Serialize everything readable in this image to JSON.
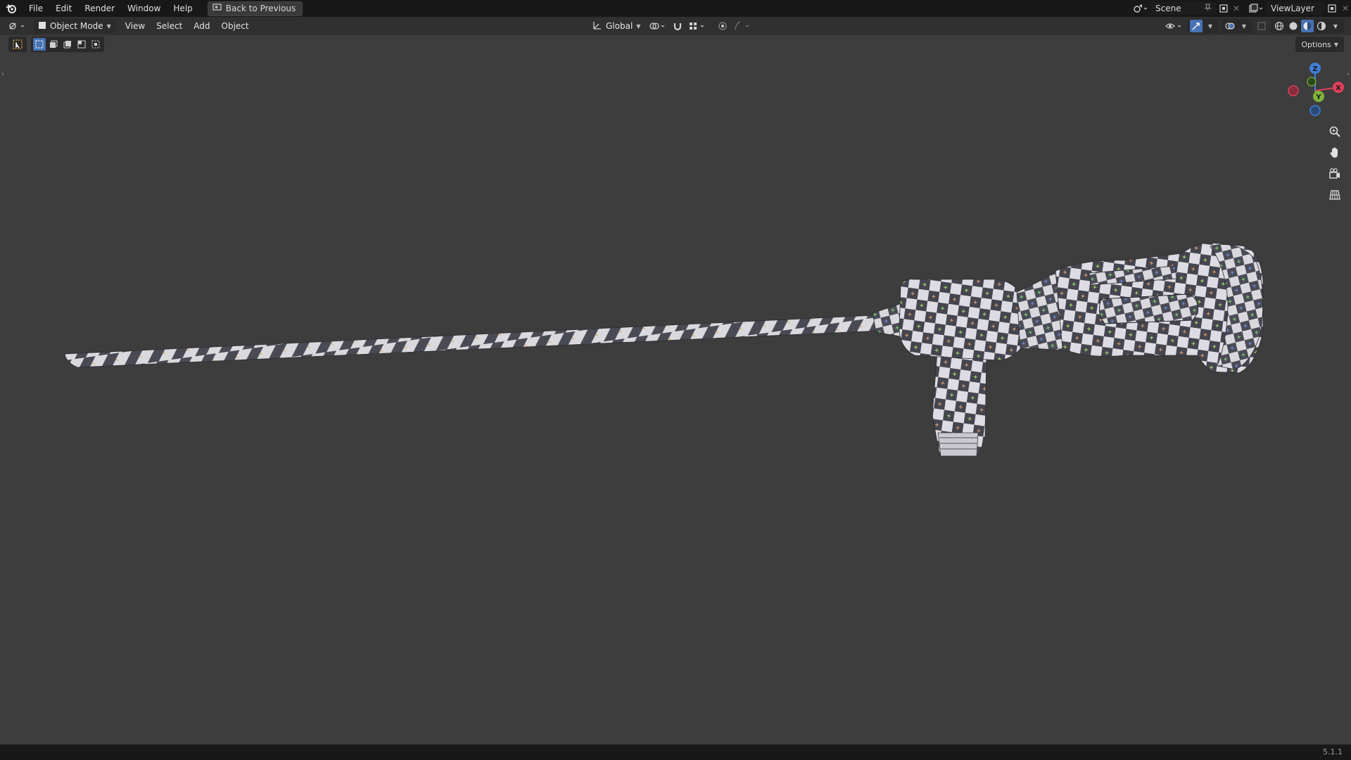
{
  "topbar": {
    "menu": [
      "File",
      "Edit",
      "Render",
      "Window",
      "Help"
    ],
    "back_button": "Back to Previous",
    "scene_name": "Scene",
    "view_layer": "ViewLayer"
  },
  "header": {
    "mode": "Object Mode",
    "menus": [
      "View",
      "Select",
      "Add",
      "Object"
    ],
    "transform_orientation": "Global",
    "options_label": "Options"
  },
  "gizmo": {
    "x": "X",
    "y": "Y",
    "z": "Z"
  },
  "status": {
    "version": "5.1.1"
  },
  "viewport": {
    "background": "#3d3d3d",
    "object": "checker-textured instrument mesh (long shaft with handle)",
    "checker_colors": [
      "#d9d9de",
      "#4a4a55"
    ]
  },
  "colors": {
    "accent": "#4772b3",
    "x_axis": "#e0405a",
    "y_axis": "#7fb33a",
    "z_axis": "#3f7fd8"
  }
}
